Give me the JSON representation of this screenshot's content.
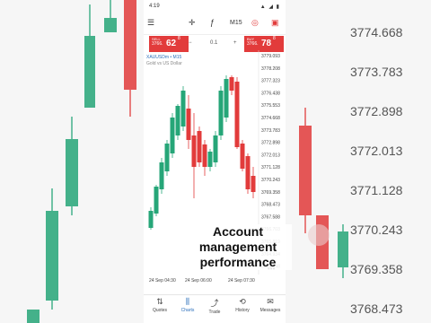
{
  "status": {
    "time": "4:19",
    "icons": "▲ ◢ ▮"
  },
  "toolbar": {
    "menu_icon": "hamburger-icon",
    "crosshair_icon": "crosshair-icon",
    "indicator_icon": "indicator-icon",
    "timeframe": "M15",
    "toggle_icon": "toggle-icon",
    "flag_icon": "flag-icon"
  },
  "quotes": {
    "sell": {
      "label": "SELL",
      "price_prefix": "3766.",
      "price_big": "62",
      "sup": "8"
    },
    "lot": "0.1",
    "buy": {
      "label": "BUY",
      "price_prefix": "3766.",
      "price_big": "78",
      "sup": "8"
    }
  },
  "chart_header": {
    "symbol": "XAUUSDm • M15",
    "subtitle": "Gold vs US Dollar"
  },
  "price_axis": [
    "3779.093",
    "3778.208",
    "3777.323",
    "3776.438",
    "3775.553",
    "3774.668",
    "3773.783",
    "3772.898",
    "3772.013",
    "3771.128",
    "3770.243",
    "3769.358",
    "3768.473",
    "3767.588",
    "3766.703",
    "3765.819",
    "3764.934",
    "3764.048"
  ],
  "time_axis": [
    "24 Sep 04:30",
    "24 Sep 06:00",
    "24 Sep 07:30"
  ],
  "background_price_axis": [
    "3774.668",
    "3773.783",
    "3772.898",
    "3772.013",
    "3771.128",
    "3770.243",
    "3769.358",
    "3768.473"
  ],
  "overlay_text": [
    "Account",
    "management",
    "performance"
  ],
  "more_icon": "more-icon",
  "nav": [
    {
      "label": "Quotes",
      "icon": "quotes-icon",
      "glyph": "⇅"
    },
    {
      "label": "Charts",
      "icon": "charts-icon",
      "glyph": "⫼"
    },
    {
      "label": "Trade",
      "icon": "trade-icon",
      "glyph": "⤴"
    },
    {
      "label": "History",
      "icon": "history-icon",
      "glyph": "⟲"
    },
    {
      "label": "Messages",
      "icon": "messages-icon",
      "glyph": "✉"
    }
  ],
  "colors": {
    "bull": "#26a678",
    "bear": "#e23b3b",
    "accent": "#2a6ebb"
  }
}
